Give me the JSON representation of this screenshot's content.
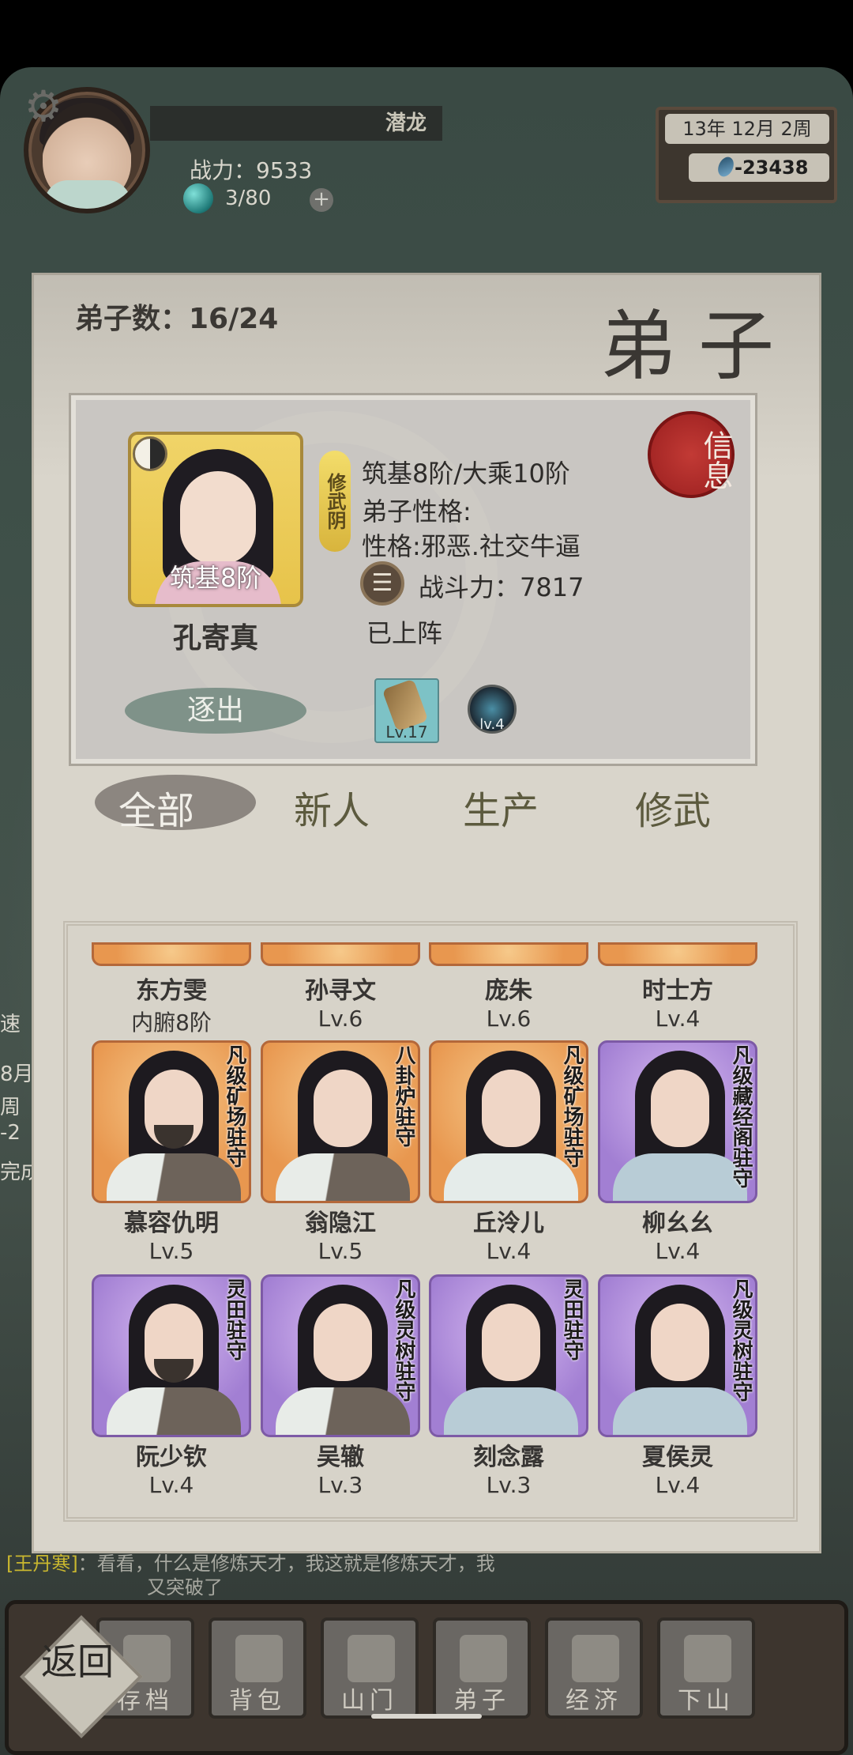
{
  "header": {
    "player_name": "潜龙",
    "power": "战力：9533",
    "energy": "3/80",
    "date": "13年 12月  2周",
    "money": "-23438"
  },
  "panel": {
    "disciple_count": "弟子数：16/24",
    "title": "弟子"
  },
  "selected": {
    "name": "孔寄真",
    "rank_badge": "筑基8阶",
    "type_badge": "修武阴",
    "realm": "筑基8阶/大乘10阶",
    "personality_label": "弟子性格:",
    "personality": "性格:邪恶.社交牛逼",
    "battle_power": "战斗力：7817",
    "status": "已上阵",
    "info_seal": "信息",
    "expel_label": "逐出",
    "equip": [
      {
        "icon": "staff-icon",
        "level": "Lv.17"
      },
      {
        "icon": "orb-icon",
        "level": "lv.4"
      }
    ]
  },
  "tabs": [
    {
      "label": "全部",
      "active": true
    },
    {
      "label": "新人",
      "active": false
    },
    {
      "label": "生产",
      "active": false
    },
    {
      "label": "修武",
      "active": false
    }
  ],
  "disciples": [
    {
      "name": "东方雯",
      "level": "内腑8阶",
      "job": "",
      "frame": "gold"
    },
    {
      "name": "孙寻文",
      "level": "Lv.6",
      "job": "",
      "frame": "gold"
    },
    {
      "name": "庞朱",
      "level": "Lv.6",
      "job": "",
      "frame": "gold"
    },
    {
      "name": "时士方",
      "level": "Lv.4",
      "job": "",
      "frame": "gold"
    },
    {
      "name": "慕容仇明",
      "level": "Lv.5",
      "job": "凡级矿场驻守",
      "frame": "gold"
    },
    {
      "name": "翁隐江",
      "level": "Lv.5",
      "job": "八卦炉驻守",
      "frame": "gold"
    },
    {
      "name": "丘泠儿",
      "level": "Lv.4",
      "job": "凡级矿场驻守",
      "frame": "gold"
    },
    {
      "name": "柳幺幺",
      "level": "Lv.4",
      "job": "凡级藏经阁驻守",
      "frame": "purple"
    },
    {
      "name": "阮少钦",
      "level": "Lv.4",
      "job": "灵田驻守",
      "frame": "purple"
    },
    {
      "name": "吴辙",
      "level": "Lv.3",
      "job": "凡级灵树驻守",
      "frame": "purple"
    },
    {
      "name": "刻念露",
      "level": "Lv.3",
      "job": "灵田驻守",
      "frame": "purple"
    },
    {
      "name": "夏侯灵",
      "level": "Lv.4",
      "job": "凡级灵树驻守",
      "frame": "purple"
    }
  ],
  "chat": {
    "speaker": "[王丹寒]",
    "line1": "：看看，什么是修炼天才，我这就是修炼天才，我",
    "line2": "又突破了"
  },
  "nav": [
    {
      "label": "存档",
      "icon": "scroll-icon"
    },
    {
      "label": "背包",
      "icon": "bag-icon"
    },
    {
      "label": "山门",
      "icon": "gate-icon"
    },
    {
      "label": "弟子",
      "icon": "disciple-icon"
    },
    {
      "label": "经济",
      "icon": "coins-icon"
    },
    {
      "label": "下山",
      "icon": "mountain-icon"
    }
  ],
  "back_label": "返回",
  "side_hints": [
    "速",
    "8月",
    "周",
    "-2",
    "完成"
  ]
}
